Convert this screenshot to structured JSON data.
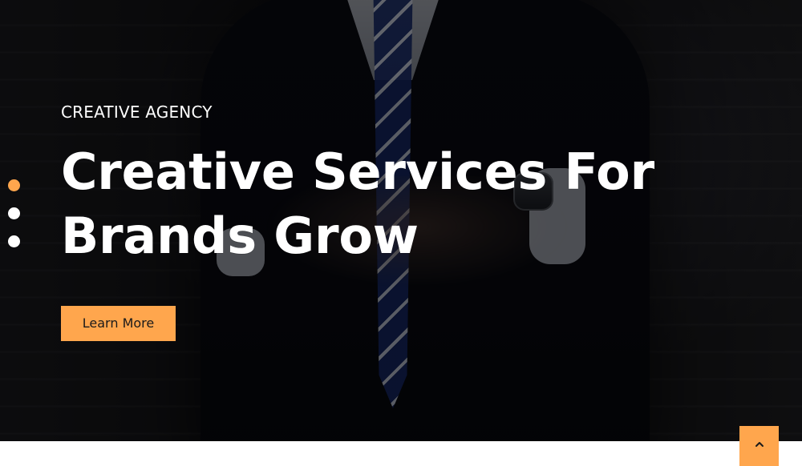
{
  "hero": {
    "eyebrow": "CREATIVE AGENCY",
    "headline": "Creative Services For Brands Grow",
    "cta_label": "Learn More",
    "slides": [
      {
        "active": true
      },
      {
        "active": false
      },
      {
        "active": false
      }
    ]
  },
  "controls": {
    "back_to_top_icon": "chevron-up-icon"
  },
  "colors": {
    "accent": "#ffa64d",
    "text_light": "#ffffff",
    "overlay": "#000000"
  }
}
